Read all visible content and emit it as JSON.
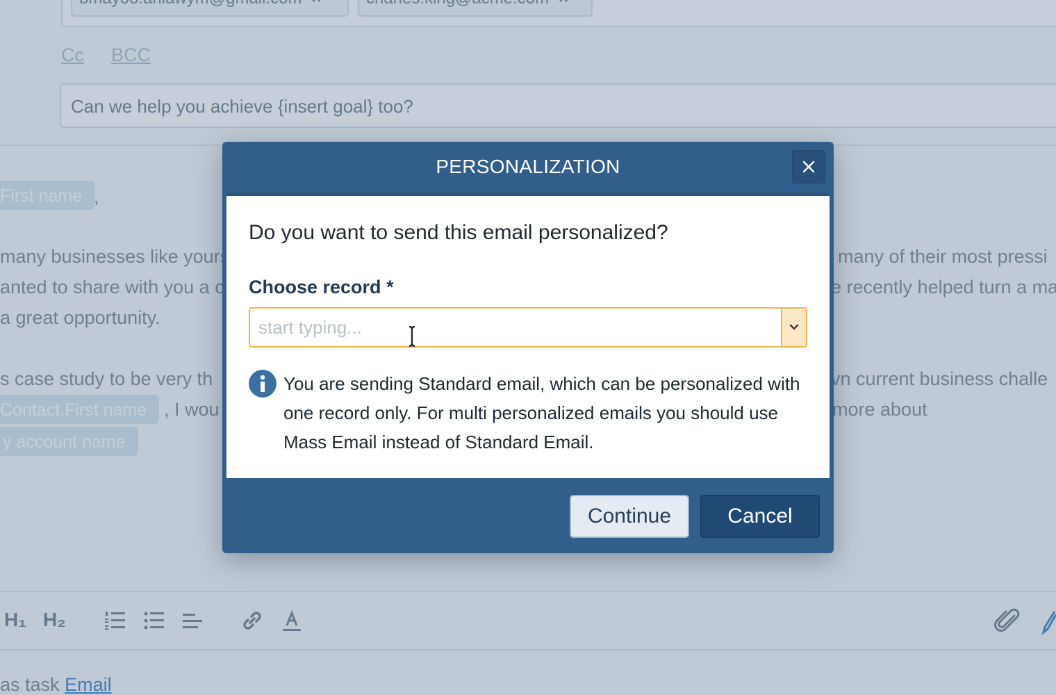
{
  "composer": {
    "recipients": [
      {
        "email": "bmayoo.anlawym@gmail.com",
        "remove": "×"
      },
      {
        "email": "charles.king@acme.com",
        "remove": "×"
      }
    ],
    "cc_label": "Cc",
    "bcc_label": "BCC",
    "subject": "Can we help you achieve {insert goal} too?",
    "body": {
      "tag_first_name": "First name",
      "comma": ",",
      "p1_left": "many businesses like yours",
      "p1_right": "many of their most pressi",
      "p2_left": "anted to share with you a c",
      "p2_right": "e recently helped turn a ma",
      "p3": "a great opportunity.",
      "p4_left": "s case study to be very th",
      "p4_right": "vn current business challe",
      "tag_contact_first_name": "Contact.First name",
      "p5_mid": ", I wou",
      "p5_right": "more about",
      "tag_account_name": "y account name"
    },
    "toolbar": {
      "h1": "H₁",
      "h2": "H₂"
    },
    "task": {
      "prefix": "as task",
      "link": "Email"
    }
  },
  "dialog": {
    "title": "PERSONALIZATION",
    "question": "Do you want to send this email personalized?",
    "field_label": "Choose record",
    "required_marker": "*",
    "input_placeholder": "start typing...",
    "info": "You are sending Standard email, which can be personalized with one record only. For multi personalized emails you should use Mass Email instead of Standard Email.",
    "continue_label": "Continue",
    "cancel_label": "Cancel"
  },
  "colors": {
    "dialog_header": "#325e8b",
    "input_border": "#f3b34f",
    "dropdown_bg": "#fde7c4",
    "cancel_bg": "#204a74",
    "info_icon": "#3e6fa3"
  }
}
